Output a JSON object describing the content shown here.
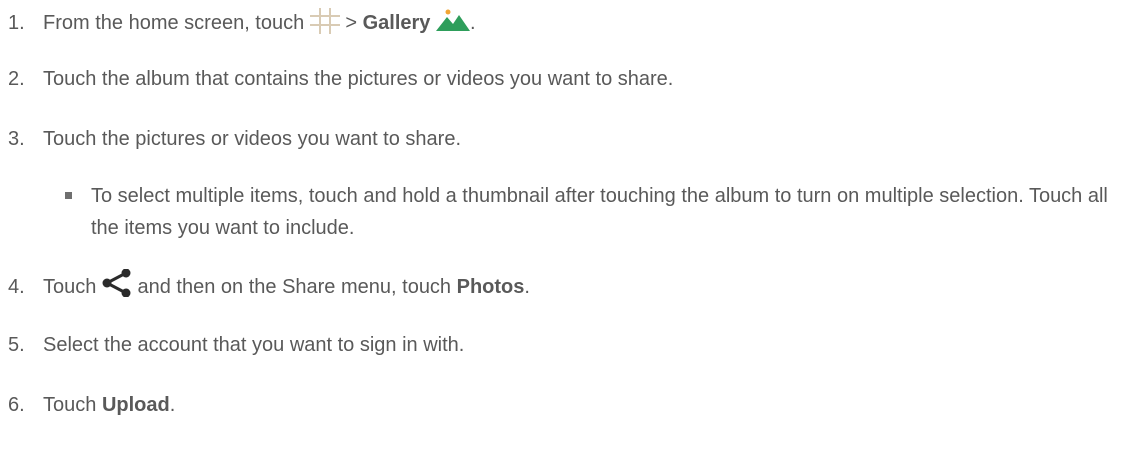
{
  "steps": [
    {
      "num": "1.",
      "text_before": "From the home screen, touch ",
      "sep": " > ",
      "bold": "Gallery",
      "text_after": ".",
      "icons": [
        "apps-grid-icon",
        "gallery-icon"
      ]
    },
    {
      "num": "2.",
      "text": "Touch the album that contains the pictures or videos you want to share."
    },
    {
      "num": "3.",
      "text": "Touch the pictures or videos you want to share."
    },
    {
      "num": "4.",
      "text_before": "Touch ",
      "text_mid": " and then on the Share menu, touch ",
      "bold": "Photos",
      "text_after": ".",
      "icons": [
        "share-icon"
      ]
    },
    {
      "num": "5.",
      "text": "Select the account that you want to sign in with."
    },
    {
      "num": "6.",
      "text_before": "Touch ",
      "bold": "Upload",
      "text_after": "."
    }
  ],
  "substep": {
    "text": "To select multiple items, touch and hold a thumbnail after touching the album to turn on multiple selection. Touch all the items you want to include."
  },
  "colors": {
    "text": "#595959",
    "gallery_green": "#2e9e5b",
    "gallery_dot": "#f2a533",
    "grid_lines": "#d9cbb4"
  }
}
